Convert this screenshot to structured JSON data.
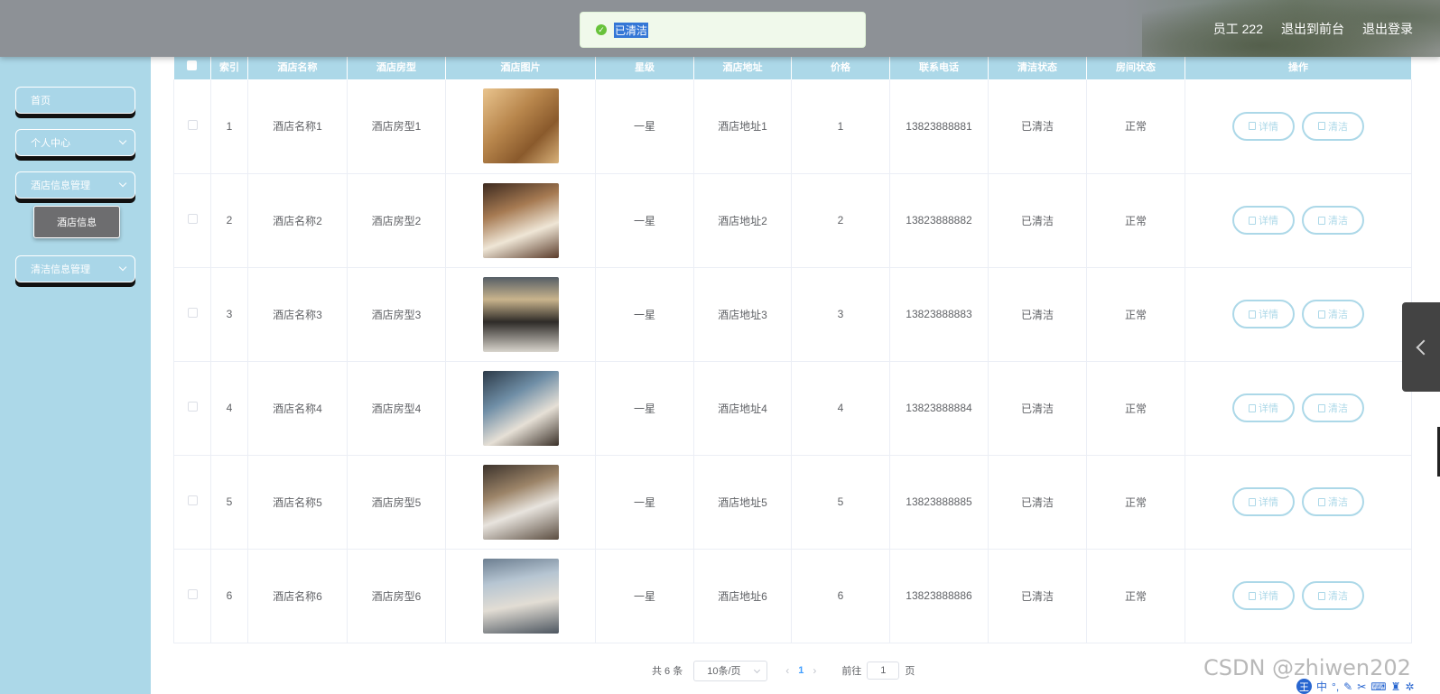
{
  "header": {
    "user": "员工 222",
    "links": [
      "退出到前台",
      "退出登录"
    ]
  },
  "toast": {
    "message": "已清洁",
    "status_color": "#67c23a"
  },
  "sidebar": {
    "menus": [
      {
        "label": "首页",
        "expandable": false
      },
      {
        "label": "个人中心",
        "expandable": true
      },
      {
        "label": "酒店信息管理",
        "expandable": true
      },
      {
        "label": "清洁信息管理",
        "expandable": true
      }
    ],
    "active_sub_item": "酒店信息"
  },
  "table": {
    "columns": [
      "索引",
      "酒店名称",
      "酒店房型",
      "酒店图片",
      "星级",
      "酒店地址",
      "价格",
      "联系电话",
      "清洁状态",
      "房间状态",
      "操作"
    ],
    "rows": [
      {
        "index": "1",
        "name": "酒店名称1",
        "room_type": "酒店房型1",
        "stars": "一星",
        "address": "酒店地址1",
        "price": "1",
        "phone": "13823888881",
        "clean_status": "已清洁",
        "room_status": "正常"
      },
      {
        "index": "2",
        "name": "酒店名称2",
        "room_type": "酒店房型2",
        "stars": "一星",
        "address": "酒店地址2",
        "price": "2",
        "phone": "13823888882",
        "clean_status": "已清洁",
        "room_status": "正常"
      },
      {
        "index": "3",
        "name": "酒店名称3",
        "room_type": "酒店房型3",
        "stars": "一星",
        "address": "酒店地址3",
        "price": "3",
        "phone": "13823888883",
        "clean_status": "已清洁",
        "room_status": "正常"
      },
      {
        "index": "4",
        "name": "酒店名称4",
        "room_type": "酒店房型4",
        "stars": "一星",
        "address": "酒店地址4",
        "price": "4",
        "phone": "13823888884",
        "clean_status": "已清洁",
        "room_status": "正常"
      },
      {
        "index": "5",
        "name": "酒店名称5",
        "room_type": "酒店房型5",
        "stars": "一星",
        "address": "酒店地址5",
        "price": "5",
        "phone": "13823888885",
        "clean_status": "已清洁",
        "room_status": "正常"
      },
      {
        "index": "6",
        "name": "酒店名称6",
        "room_type": "酒店房型6",
        "stars": "一星",
        "address": "酒店地址6",
        "price": "6",
        "phone": "13823888886",
        "clean_status": "已清洁",
        "room_status": "正常"
      }
    ],
    "actions": {
      "detail": "详情",
      "clean": "清洁"
    },
    "accent_color": "#acd8e8"
  },
  "pagination": {
    "total_text": "共 6 条",
    "page_size": "10条/页",
    "current_page": "1",
    "goto_label": "前往",
    "goto_value": "1",
    "page_suffix": "页"
  },
  "watermark": "CSDN @zhiwen202",
  "ime": {
    "logo": "王",
    "mode": "中"
  }
}
